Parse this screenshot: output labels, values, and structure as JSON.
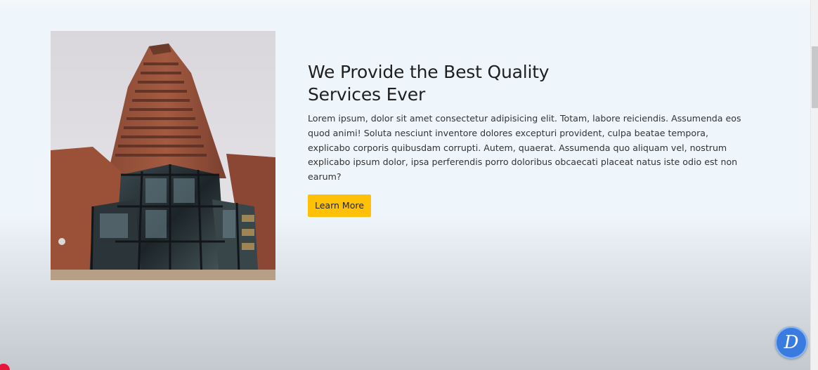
{
  "section": {
    "title": "We Provide the Best Quality Services Ever",
    "description": "Lorem ipsum, dolor sit amet consectetur adipisicing elit. Totam, labore reiciendis. Assumenda eos quod animi! Soluta nesciunt inventore dolores excepturi provident, culpa beatae tempora, explicabo corporis quibusdam corrupti. Autem, quaerat. Assumenda quo aliquam vel, nostrum explicabo ipsum dolor, ipsa perferendis porro doloribus obcaecati placeat natus iste odio est non earum?",
    "button_label": "Learn More",
    "image_icon": "building-photo"
  },
  "badge": {
    "letter": "D",
    "icon": "d-logo-icon"
  },
  "colors": {
    "button": "#ffc107",
    "heading": "#1f1f1f",
    "badge": "#3a7be0"
  }
}
